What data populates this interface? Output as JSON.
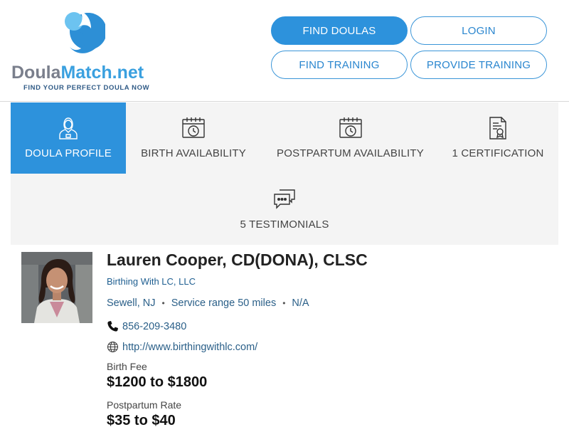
{
  "brand": {
    "name_part1": "Doula",
    "name_part2": "Match.net",
    "tagline": "FIND YOUR PERFECT DOULA NOW",
    "colors": {
      "primary": "#2d92dc",
      "light": "#6cc3f0",
      "text_gray": "#7a7f8c"
    }
  },
  "nav": {
    "find_doulas": "FIND DOULAS",
    "login": "LOGIN",
    "find_training": "FIND TRAINING",
    "provide_training": "PROVIDE TRAINING"
  },
  "tabs": [
    {
      "label": "DOULA PROFILE",
      "icon": "user-icon",
      "active": true
    },
    {
      "label": "BIRTH AVAILABILITY",
      "icon": "calendar-clock-icon",
      "active": false
    },
    {
      "label": "POSTPARTUM AVAILABILITY",
      "icon": "calendar-clock-icon",
      "active": false
    },
    {
      "label": "1 CERTIFICATION",
      "icon": "certificate-icon",
      "active": false
    },
    {
      "label": "5 TESTIMONIALS",
      "icon": "chat-bubbles-icon",
      "active": false
    }
  ],
  "profile": {
    "name": "Lauren Cooper, CD(DONA), CLSC",
    "business": "Birthing With LC, LLC",
    "location": "Sewell, NJ",
    "service_range": "Service range 50 miles",
    "extra": "N/A",
    "separator": "•",
    "phone": "856-209-3480",
    "website": "http://www.birthingwithlc.com/",
    "birth_fee_label": "Birth Fee",
    "birth_fee": "$1200 to $1800",
    "postpartum_label": "Postpartum Rate",
    "postpartum_rate": "$35 to $40"
  }
}
